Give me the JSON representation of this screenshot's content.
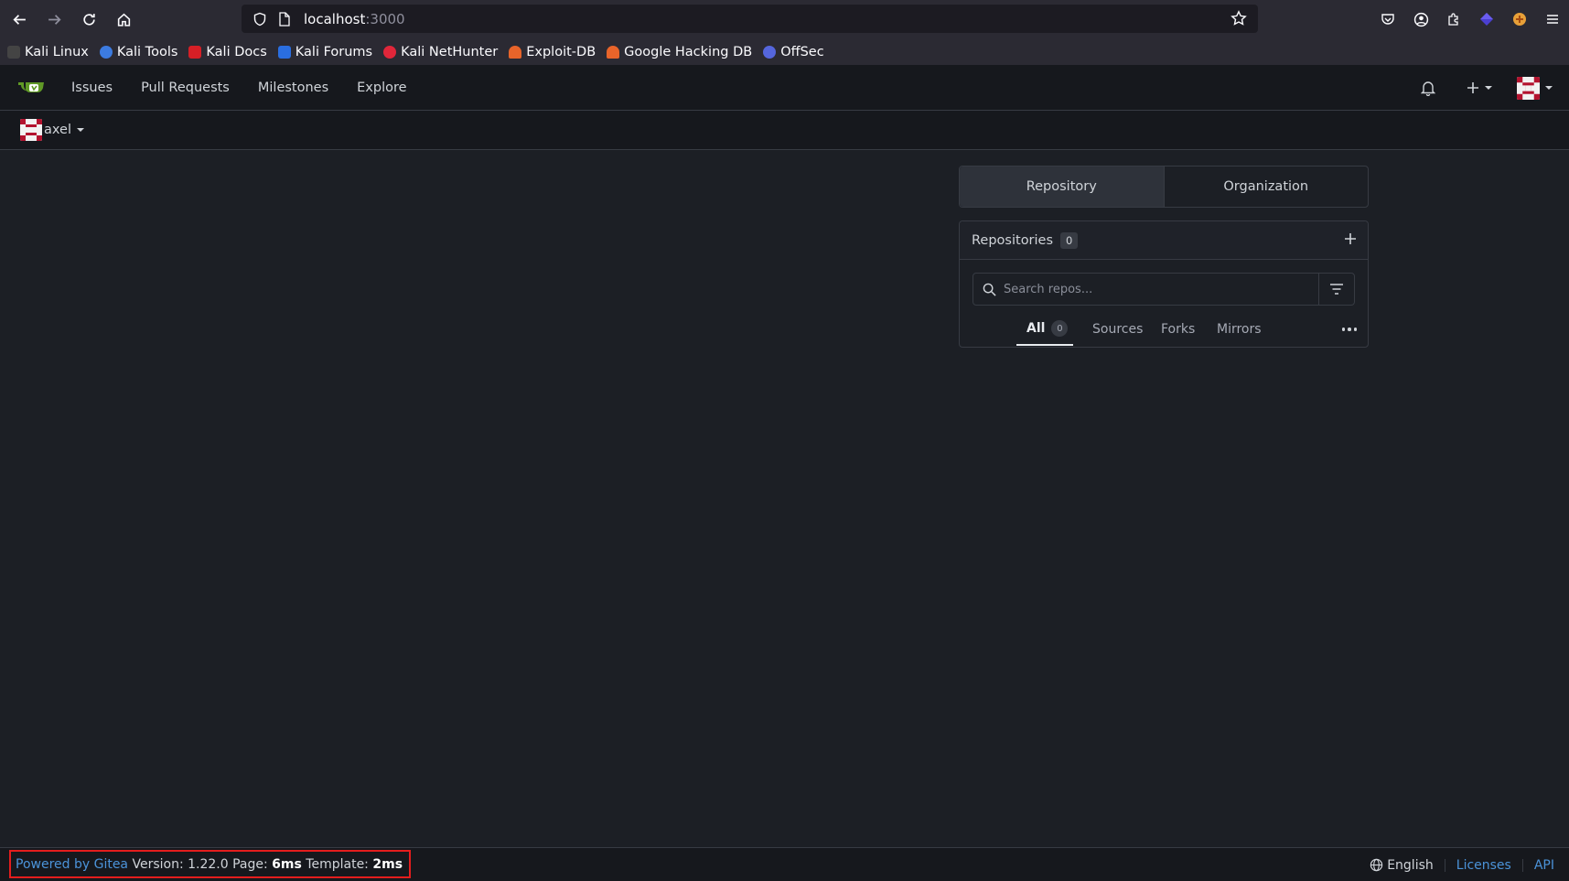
{
  "browser": {
    "url_host": "localhost",
    "url_port": ":3000",
    "bookmarks": [
      {
        "label": "Kali Linux",
        "color": "#444444"
      },
      {
        "label": "Kali Tools",
        "color": "#3c7be0"
      },
      {
        "label": "Kali Docs",
        "color": "#d61f26"
      },
      {
        "label": "Kali Forums",
        "color": "#2a6ee0"
      },
      {
        "label": "Kali NetHunter",
        "color": "#e0263a"
      },
      {
        "label": "Exploit-DB",
        "color": "#e8642a"
      },
      {
        "label": "Google Hacking DB",
        "color": "#e8642a"
      },
      {
        "label": "OffSec",
        "color": "#5566dd"
      }
    ]
  },
  "nav": {
    "items": [
      "Issues",
      "Pull Requests",
      "Milestones",
      "Explore"
    ]
  },
  "context": {
    "username": "axel"
  },
  "dashboard": {
    "switch": {
      "repository": "Repository",
      "organization": "Organization"
    },
    "repos_title": "Repositories",
    "repos_count": "0",
    "search_placeholder": "Search repos...",
    "tabs": {
      "all": "All",
      "all_count": "0",
      "sources": "Sources",
      "forks": "Forks",
      "mirrors": "Mirrors"
    }
  },
  "footer": {
    "powered": "Powered by Gitea",
    "version_label": "Version:",
    "version": "1.22.0",
    "page_label": "Page:",
    "page_time": "6ms",
    "template_label": "Template:",
    "template_time": "2ms",
    "language": "English",
    "licenses": "Licenses",
    "api": "API"
  },
  "colors": {
    "accent_link": "#4b93d9",
    "highlight_box": "#e41d1d",
    "gitea_green": "#609926"
  }
}
